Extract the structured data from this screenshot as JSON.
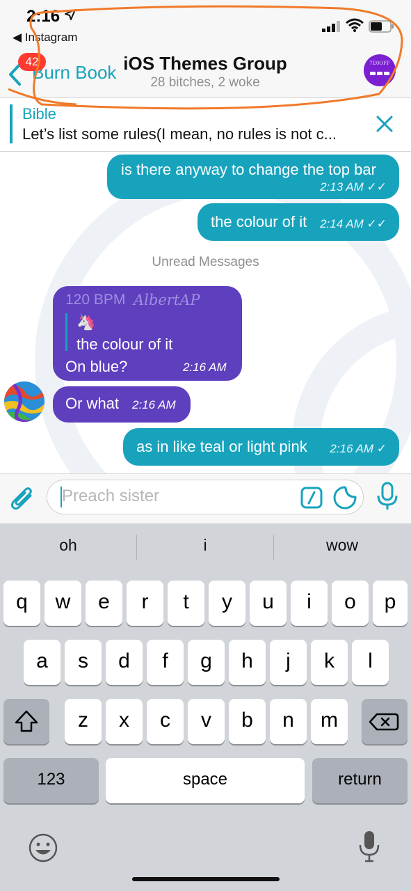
{
  "status_bar": {
    "time": "2:16",
    "back_app": "◀ Instagram"
  },
  "nav": {
    "back_label": "Burn Book",
    "unread_badge": "42",
    "title": "iOS Themes Group",
    "subtitle": "28 bitches, 2 woke",
    "avatar_text": "7E0OFF"
  },
  "pinned": {
    "title": "Bible",
    "text": "Let’s list some rules(I mean, no rules is not c..."
  },
  "messages": [
    {
      "text": "is there anyway to change the top bar",
      "time": "2:13 AM"
    },
    {
      "text": "the colour of it",
      "time": "2:14 AM"
    },
    {
      "text": "On blue?",
      "time": "2:16 AM",
      "sender": "120 BPM",
      "sender_title": "AlbertAP",
      "quote_text": "the colour of it",
      "quote_emoji": "🦄"
    },
    {
      "text": "Or what",
      "time": "2:16 AM"
    },
    {
      "text": "as in like teal or light pink",
      "time": "2:16 AM"
    }
  ],
  "unread_label": "Unread Messages",
  "input": {
    "placeholder": "Preach sister"
  },
  "keyboard": {
    "suggestions": [
      "oh",
      "i",
      "wow"
    ],
    "row1": [
      "q",
      "w",
      "e",
      "r",
      "t",
      "y",
      "u",
      "i",
      "o",
      "p"
    ],
    "row2": [
      "a",
      "s",
      "d",
      "f",
      "g",
      "h",
      "j",
      "k",
      "l"
    ],
    "row3": [
      "z",
      "x",
      "c",
      "v",
      "b",
      "n",
      "m"
    ],
    "numbers_key": "123",
    "space_key": "space",
    "return_key": "return"
  },
  "colors": {
    "accent": "#18a3bd",
    "incoming": "#5e3fbe",
    "badge": "#ff3b30",
    "scribble": "#f07a2a"
  }
}
